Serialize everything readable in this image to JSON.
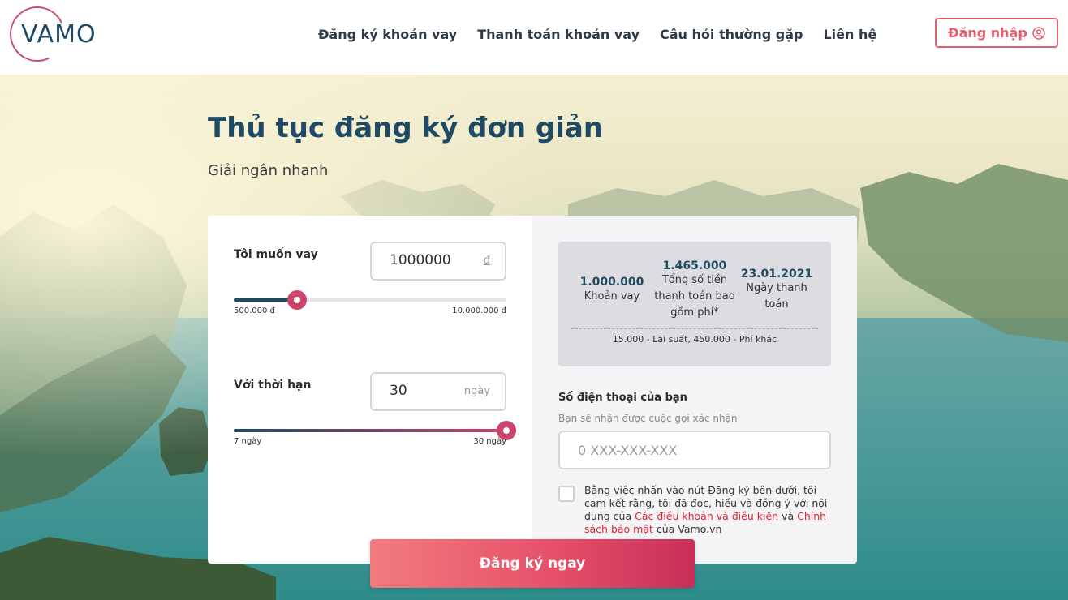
{
  "brand": {
    "logo_text": "VAMO"
  },
  "nav": {
    "items": [
      "Đăng ký khoản vay",
      "Thanh toán khoản vay",
      "Câu hỏi thường gặp",
      "Liên hệ"
    ],
    "login_label": "Đăng nhập"
  },
  "hero": {
    "title": "Thủ tục đăng ký đơn giản",
    "subtitle": "Giải ngân nhanh"
  },
  "loan": {
    "amount_label": "Tôi muốn vay",
    "amount_value": "1000000",
    "amount_unit": "đ",
    "amount_min_label": "500.000 đ",
    "amount_max_label": "10.000.000 đ",
    "amount_min": 500000,
    "amount_max": 10000000,
    "amount_current": 1000000,
    "term_label": "Với thời hạn",
    "term_value": "30",
    "term_unit": "ngày",
    "term_min_label": "7 ngày",
    "term_max_label": "30 ngày",
    "term_min": 7,
    "term_max": 30,
    "term_current": 30
  },
  "summary": {
    "loan_value": "1.000.000",
    "loan_label": "Khoản vay",
    "total_value": "1.465.000",
    "total_label": "Tổng số tiền thanh toán bao gồm phí*",
    "date_value": "23.01.2021",
    "date_label": "Ngày thanh toán",
    "footnote": "15.000 - Lãi suất, 450.000 - Phí khác"
  },
  "phone": {
    "label": "Số điện thoại của bạn",
    "hint": "Bạn sẽ nhận được cuộc gọi xác nhận",
    "placeholder": "0 XXX-XXX-XXX"
  },
  "agreement": {
    "text_1": "Bằng việc nhấn vào nút Đăng ký bên dưới, tôi cam kết rằng, tôi đã đọc, hiểu và đồng ý với nội dung của ",
    "link_terms": "Các điều khoản và điều kiện",
    "text_2": " và ",
    "link_privacy": "Chính sách bảo mật",
    "text_3": " của Vamo.vn"
  },
  "submit_label": "Đăng ký ngay",
  "colors": {
    "brand_navy": "#1f4a63",
    "accent_red": "#e3606f",
    "knob": "#c9456a",
    "link_red": "#e0222f"
  }
}
